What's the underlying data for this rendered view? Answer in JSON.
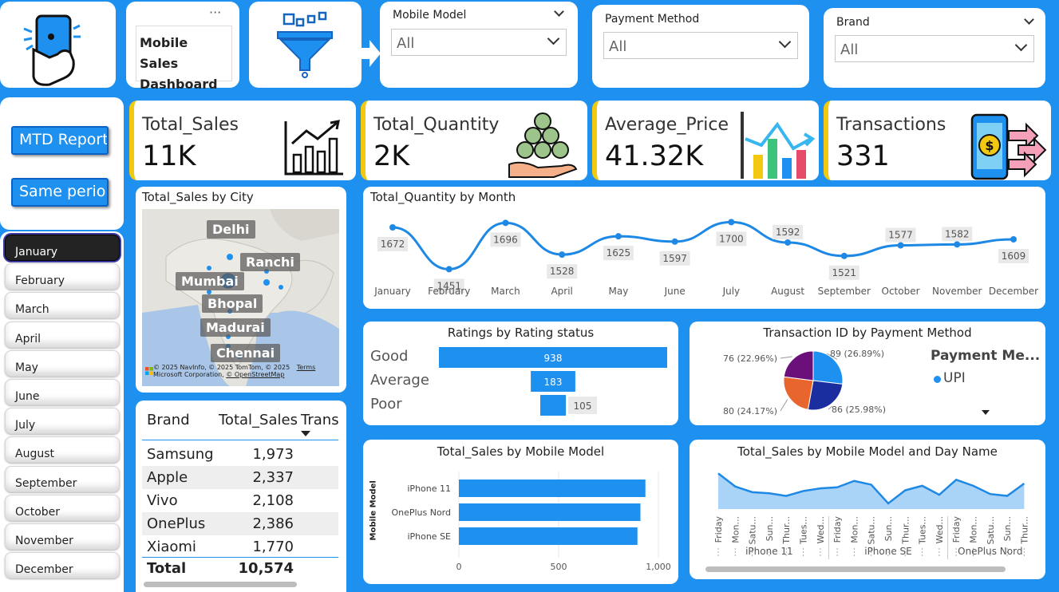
{
  "header": {
    "title": "Mobile Sales Dashboard",
    "more_glyph": "···",
    "icons": [
      "phone-hand-icon",
      "funnel-icon"
    ]
  },
  "filters": [
    {
      "title": "Mobile Model",
      "value": "All"
    },
    {
      "title": "Payment Method",
      "value": "All"
    },
    {
      "title": "Brand",
      "value": "All"
    }
  ],
  "buttons": {
    "mtd": "MTD Report",
    "same_period": "Same perio..."
  },
  "months": [
    "January",
    "February",
    "March",
    "April",
    "May",
    "June",
    "July",
    "August",
    "September",
    "October",
    "November",
    "December"
  ],
  "selected_month": "January",
  "kpis": [
    {
      "label": "Total_Sales",
      "value": "11K",
      "icon": "growth-chart-icon"
    },
    {
      "label": "Total_Quantity",
      "value": "2K",
      "icon": "coin-stack-icon"
    },
    {
      "label": "Average_Price",
      "value": "41.32K",
      "icon": "bar-trend-icon"
    },
    {
      "label": "Transactions",
      "value": "331",
      "icon": "mobile-payment-icon"
    }
  ],
  "map": {
    "title": "Total_Sales by City",
    "cities": [
      "Delhi",
      "Ranchi",
      "Mumbai",
      "Bhopal",
      "Madurai",
      "Chennai"
    ],
    "attribution": "© 2025 NavInfo, © 2025 TomTom, © 2025",
    "attribution2": "Microsoft Corporation,",
    "osm": "© OpenStreetMap",
    "terms": "Terms"
  },
  "brand_table": {
    "headers": [
      "Brand",
      "Total_Sales",
      "Transa"
    ],
    "rows": [
      {
        "brand": "Samsung",
        "sales": "1,973"
      },
      {
        "brand": "Apple",
        "sales": "2,337"
      },
      {
        "brand": "Vivo",
        "sales": "2,108"
      },
      {
        "brand": "OnePlus",
        "sales": "2,386"
      },
      {
        "brand": "Xiaomi",
        "sales": "1,770"
      }
    ],
    "total_label": "Total",
    "total_value": "10,574"
  },
  "charts": {
    "quantity_title": "Total_Quantity by Month",
    "ratings_title": "Ratings by Rating status",
    "payment_title": "Transaction ID by Payment Method",
    "payment_legend_title": "Payment Me...",
    "payment_legend_item": "UPI",
    "model_title": "Total_Sales by Mobile Model",
    "model_axis": "Mobile Model",
    "day_title": "Total_Sales by Mobile Model and Day Name"
  },
  "chart_data": [
    {
      "type": "line",
      "title": "Total_Quantity by Month",
      "categories": [
        "January",
        "February",
        "March",
        "April",
        "May",
        "June",
        "July",
        "August",
        "September",
        "October",
        "November",
        "December"
      ],
      "values": [
        1672,
        1451,
        1696,
        1528,
        1625,
        1597,
        1700,
        1592,
        1521,
        1577,
        1582,
        1609
      ],
      "color": "#1e88e5"
    },
    {
      "type": "bar",
      "title": "Ratings by Rating status",
      "categories": [
        "Good",
        "Average",
        "Poor"
      ],
      "values": [
        938,
        183,
        105
      ],
      "color": "#1e90f0"
    },
    {
      "type": "pie",
      "title": "Transaction ID by Payment Method",
      "slices": [
        {
          "value": 89,
          "label": "89 (26.89%)",
          "color": "#1e90f0"
        },
        {
          "value": 86,
          "label": "86 (25.98%)",
          "color": "#1a2ea0"
        },
        {
          "value": 80,
          "label": "80 (24.17%)",
          "color": "#e8662e"
        },
        {
          "value": 76,
          "label": "76 (22.96%)",
          "color": "#6b0f7a"
        }
      ]
    },
    {
      "type": "bar",
      "title": "Total_Sales by Mobile Model",
      "ylabel": "Mobile Model",
      "categories": [
        "iPhone 11",
        "OnePlus Nord",
        "iPhone SE"
      ],
      "values": [
        935,
        910,
        895
      ],
      "ticks": [
        "0",
        "500",
        "1,000"
      ],
      "xlim": [
        0,
        1000
      ],
      "color": "#1e90f0"
    },
    {
      "type": "area",
      "title": "Total_Sales by Mobile Model and Day Name",
      "groups": [
        {
          "name": "iPhone 11",
          "days": [
            "Friday",
            "Mon...",
            "Satu...",
            "Sun...",
            "Thur...",
            "Tues...",
            "Wed..."
          ],
          "values": [
            185,
            150,
            135,
            132,
            125,
            138,
            145
          ]
        },
        {
          "name": "iPhone SE",
          "days": [
            "Friday",
            "Mon...",
            "Satu...",
            "Sun...",
            "Thur...",
            "Tues...",
            "Wed..."
          ],
          "values": [
            148,
            165,
            155,
            105,
            140,
            152,
            128
          ]
        },
        {
          "name": "OnePlus Nord",
          "days": [
            "Friday",
            "Mon...",
            "Satu...",
            "Sun...",
            "Thur..."
          ],
          "values": [
            168,
            152,
            130,
            125,
            158
          ]
        }
      ],
      "color": "#1e88e5"
    }
  ]
}
